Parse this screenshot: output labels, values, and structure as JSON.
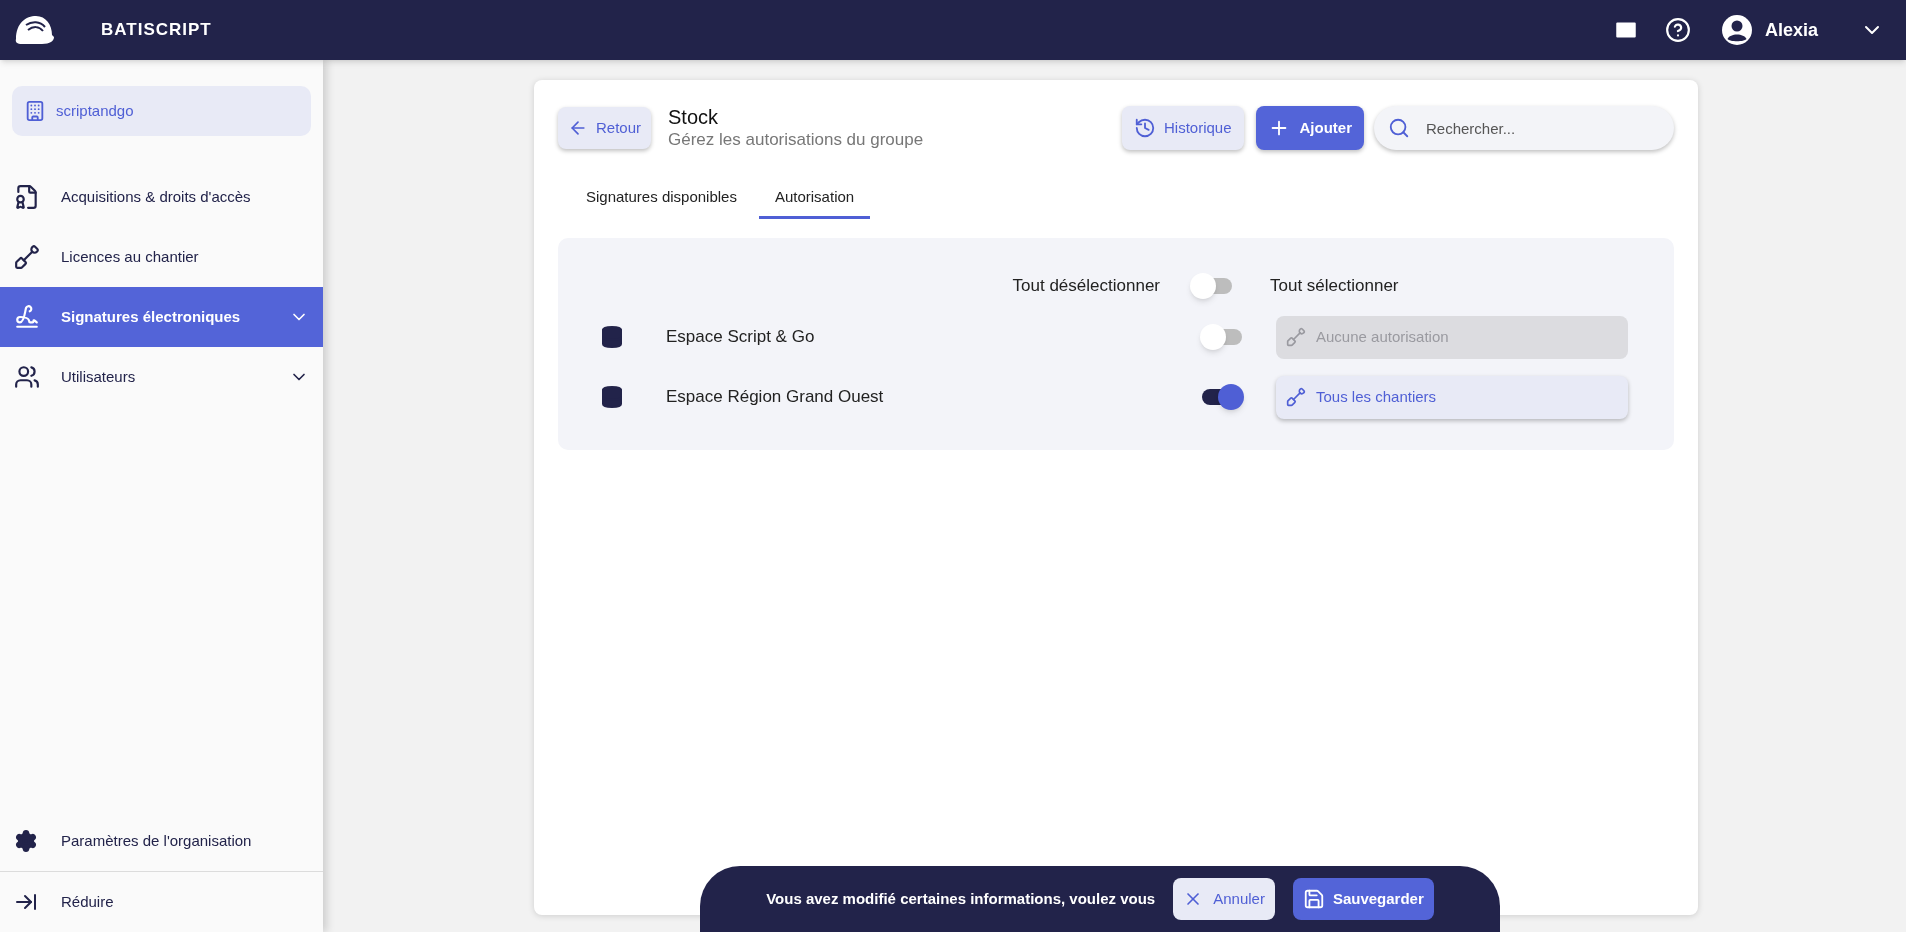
{
  "topbar": {
    "brand": "BATISCRIPT",
    "user_name": "Alexia"
  },
  "sidebar": {
    "organization": "scriptandgo",
    "items": [
      {
        "kind": "document",
        "label": "Acquisitions & droits d'accès",
        "selected": false,
        "has_submenu": false
      },
      {
        "kind": "shovel",
        "label": "Licences au chantier",
        "selected": false,
        "has_submenu": false
      },
      {
        "kind": "signature",
        "label": "Signatures électroniques",
        "selected": true,
        "has_submenu": true
      },
      {
        "kind": "users",
        "label": "Utilisateurs",
        "selected": false,
        "has_submenu": true
      }
    ],
    "settings_label": "Paramètres de l'organisation",
    "collapse_label": "Réduire"
  },
  "page": {
    "back_label": "Retour",
    "title": "Stock",
    "subtitle": "Gérez les autorisations du groupe",
    "history_label": "Historique",
    "add_label": "Ajouter",
    "search_placeholder": "Rechercher...",
    "tabs": [
      {
        "label": "Signatures disponibles",
        "selected": false
      },
      {
        "label": "Autorisation",
        "selected": true
      }
    ],
    "bulk": {
      "deselect_label": "Tout désélectionner",
      "select_label": "Tout sélectionner",
      "on": false
    },
    "spaces": [
      {
        "name": "Espace Script & Go",
        "on": false,
        "access": "Aucune autorisation"
      },
      {
        "name": "Espace Région Grand Ouest",
        "on": true,
        "access": "Tous les chantiers"
      }
    ]
  },
  "save_bar": {
    "message": "Vous avez modifié certaines informations, voulez vous",
    "cancel_label": "Annuler",
    "save_label": "Sauvegarder"
  }
}
